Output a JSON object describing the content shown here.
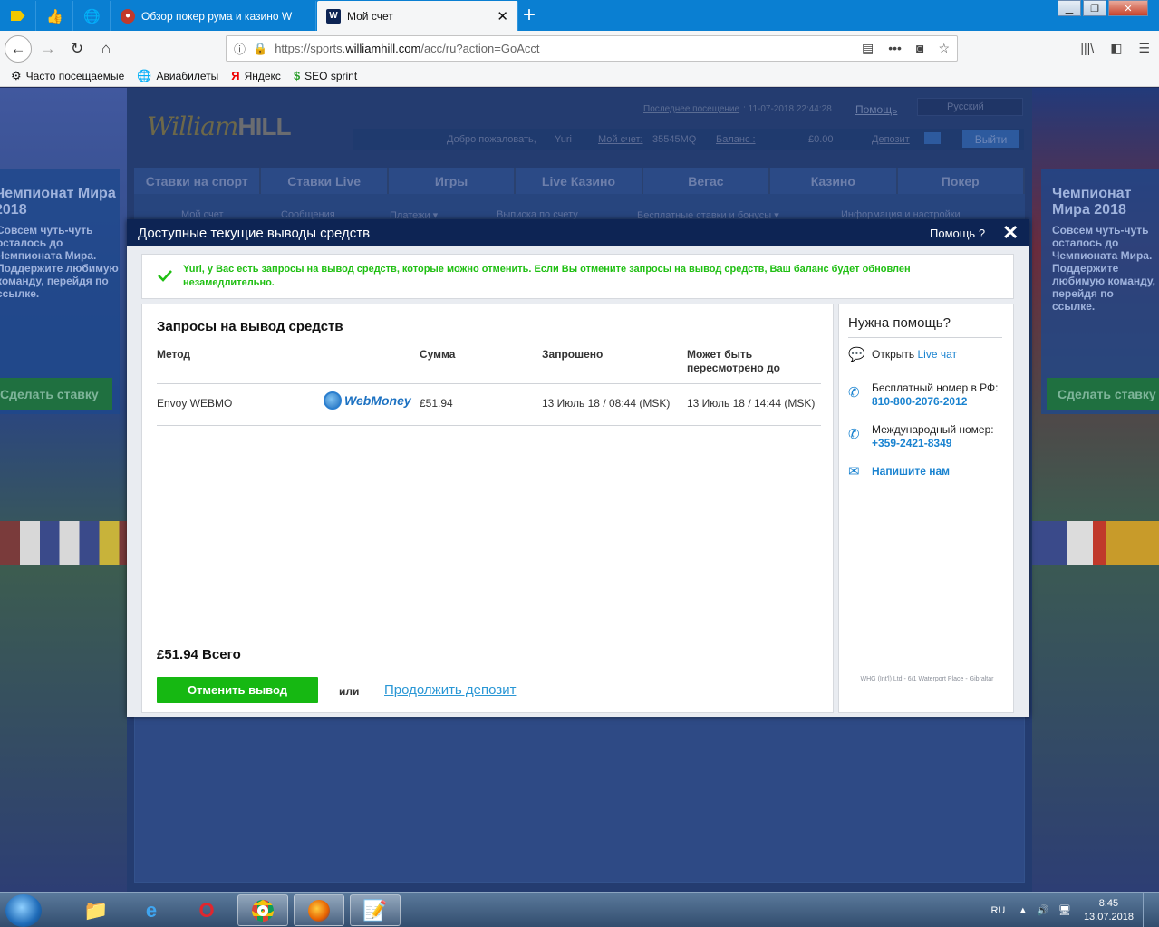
{
  "browser": {
    "tabs": [
      {
        "title": "Обзор покер рума и казино W"
      },
      {
        "title": "Мой счет"
      }
    ],
    "url_prefix": "https://sports.",
    "url_domain": "williamhill.com",
    "url_path": "/acc/ru?action=GoAcct",
    "bookmarks": [
      "Часто посещаемые",
      "Авиабилеты",
      "Яндекс",
      "SEO sprint"
    ]
  },
  "site": {
    "logo_script": "William",
    "logo_bold": "HILL",
    "last_visit_label": "Последнее посещение",
    "last_visit_value": ": 11-07-2018 22:44:28",
    "help": "Помощь",
    "language": "Русский",
    "welcome": "Добро пожаловать,",
    "username": "Yuri",
    "account_label": "Мой счет:",
    "account_number": "35545MQ",
    "balance_label": "Баланс :",
    "balance_value": "£0.00",
    "deposit_label": "Депозит",
    "logout": "Выйти",
    "main_nav": [
      "Ставки на спорт",
      "Ставки Live",
      "Игры",
      "Live Казино",
      "Вегас",
      "Казино",
      "Покер"
    ],
    "sub_nav": [
      "Мой счет",
      "Сообщения",
      "Платежи ▾",
      "Выписка по счету",
      "Бесплатные ставки и бонусы ▾",
      "Информация и настройки"
    ]
  },
  "promo_left": {
    "title": "Чемпионат Мира 2018",
    "text": "Совсем чуть-чуть осталось до Чемпионата Мира. Поддержите любимую команду, перейдя по ссылке.",
    "button": "Сделать ставку"
  },
  "promo_right": {
    "title": "Чемпионат Мира 2018",
    "text": "Совсем чуть-чуть осталось до Чемпионата Мира. Поддержите любимую команду, перейдя по ссылке.",
    "button": "Сделать ставку"
  },
  "modal": {
    "title": "Доступные текущие выводы средств",
    "help": "Помощь ?",
    "notice": "Yuri, у Вас есть запросы на вывод средств, которые можно отменить. Если Вы отмените запросы на вывод средств, Ваш баланс будет обновлен незамедлительно.",
    "panel_title": "Запросы на вывод средств",
    "columns": {
      "method": "Метод",
      "amount": "Сумма",
      "requested": "Запрошено",
      "reviewable": "Может быть пересмотрено до"
    },
    "rows": [
      {
        "method": "Envoy WEBMO",
        "provider": "WebMoney",
        "amount": "£51.94",
        "requested": "13 Июль 18 / 08:44 (MSK)",
        "reviewable": "13 Июль 18 / 14:44 (MSK)"
      }
    ],
    "total": "£51.94 Всего",
    "cancel_button": "Отменить вывод",
    "or": "или",
    "continue_link": "Продолжить депозит"
  },
  "help_panel": {
    "title": "Нужна помощь?",
    "chat_prefix": "Открыть",
    "chat_link": "Live чат",
    "free_label": "Бесплатный номер в РФ:",
    "free_number": "810-800-2076-2012",
    "intl_label": "Международный номер:",
    "intl_number": "+359-2421-8349",
    "write": "Напишите нам",
    "footer": "WHG (Int'l) Ltd - 6/1 Waterport Place - Gibraltar"
  },
  "taskbar": {
    "lang": "RU",
    "time": "8:45",
    "date": "13.07.2018"
  }
}
